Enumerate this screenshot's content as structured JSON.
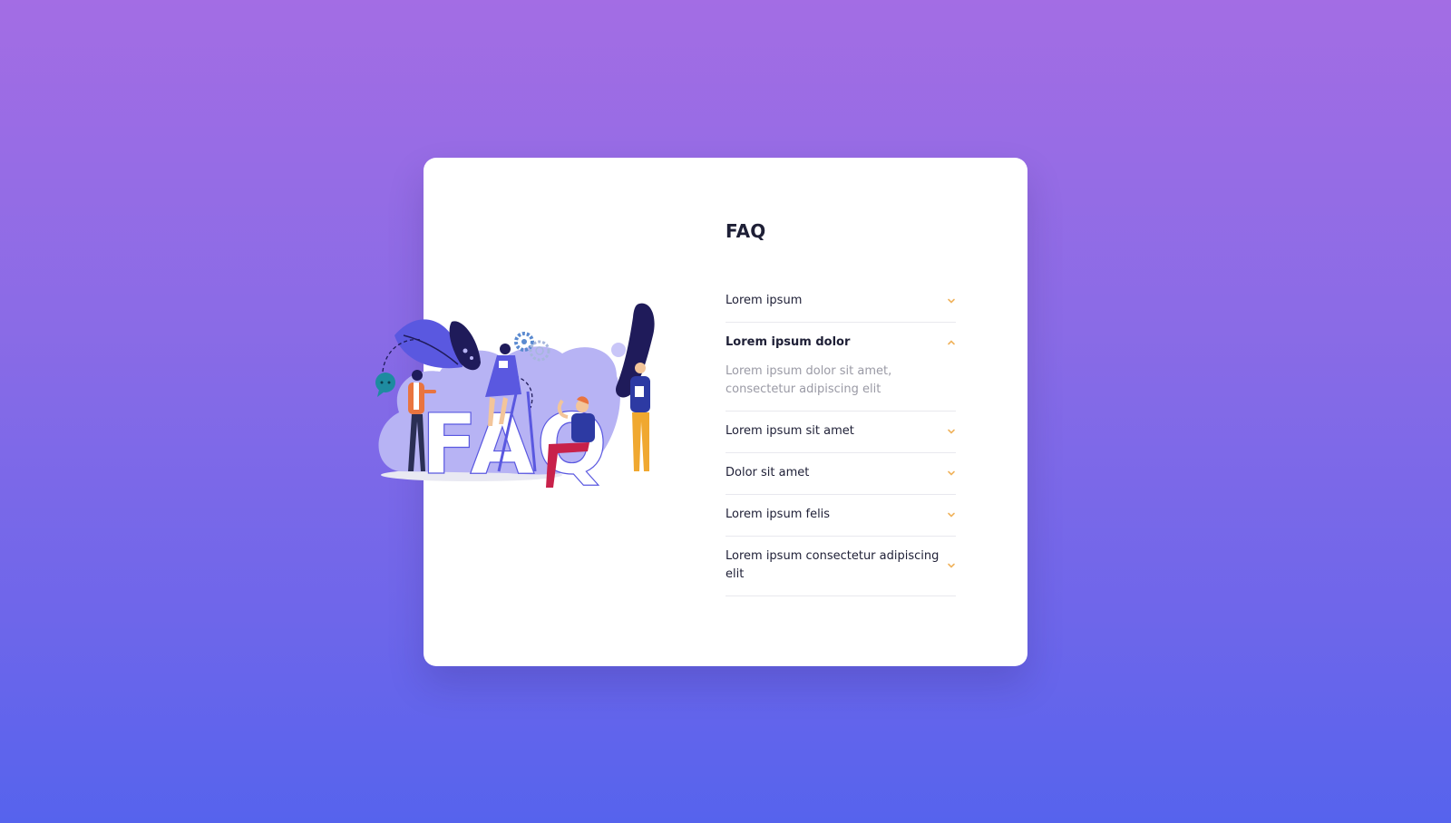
{
  "faq": {
    "title": "FAQ",
    "items": [
      {
        "question": "Lorem ipsum",
        "open": false
      },
      {
        "question": "Lorem ipsum dolor",
        "open": true,
        "answer": "Lorem ipsum dolor sit amet, consectetur adipiscing elit"
      },
      {
        "question": "Lorem ipsum sit amet",
        "open": false
      },
      {
        "question": "Dolor sit amet",
        "open": false
      },
      {
        "question": "Lorem ipsum felis",
        "open": false
      },
      {
        "question": "Lorem ipsum consectetur adipiscing elit",
        "open": false
      }
    ]
  },
  "illustration": {
    "letters": "FAQ"
  },
  "colors": {
    "bg_top": "#a36de4",
    "bg_bottom": "#5663ed",
    "card": "#ffffff",
    "title": "#1e1f36",
    "answer": "#9a9aa5",
    "chevron": "#f0b35c",
    "blob": "#b7b3f4",
    "dark": "#1f1b5a",
    "accent_blue": "#5a58e0"
  }
}
